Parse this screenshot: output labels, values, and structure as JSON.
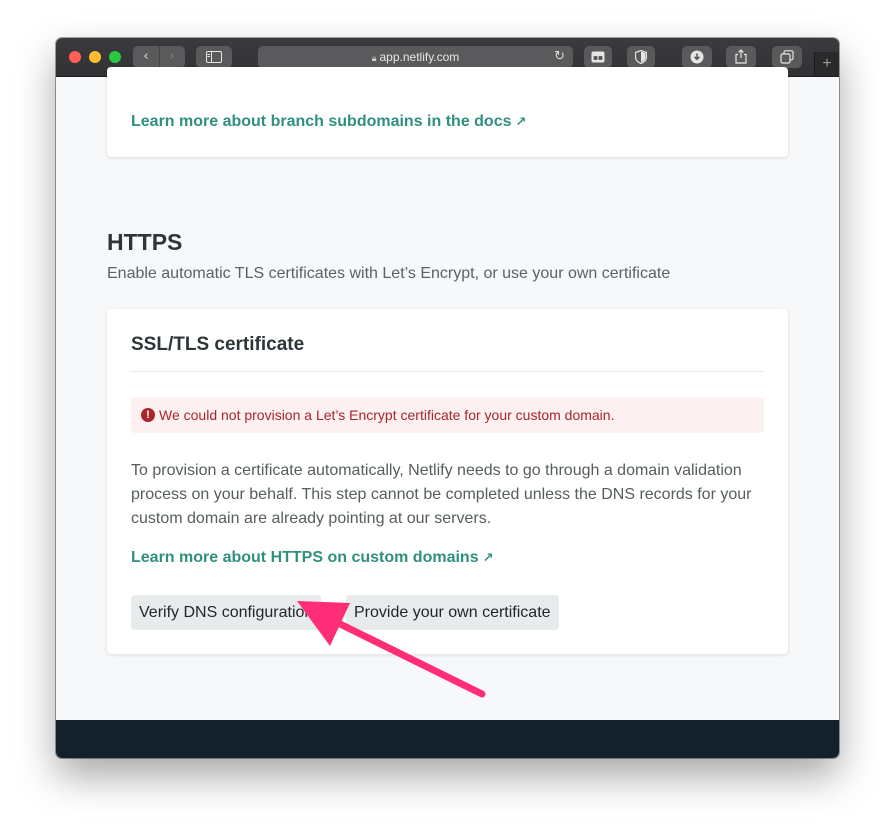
{
  "browser": {
    "url": "app.netlify.com",
    "icons": {
      "back": "chevron-left-icon",
      "forward": "chevron-right-icon",
      "sidebar": "sidebar-icon",
      "lock": "lock-icon",
      "reload": "reload-icon",
      "extension": "extension-icon",
      "shield": "shield-icon",
      "download": "download-icon",
      "share": "share-icon",
      "tabs": "tabs-icon",
      "new_tab": "plus-icon"
    }
  },
  "branch_card": {
    "link": "Learn more about branch subdomains in the docs",
    "link_arrow": "↗"
  },
  "https_section": {
    "title": "HTTPS",
    "subtitle": "Enable automatic TLS certificates with Let’s Encrypt, or use your own certificate"
  },
  "ssl_card": {
    "title": "SSL/TLS certificate",
    "alert_icon": "!",
    "alert": "We could not provision a Let’s Encrypt certificate for your custom domain.",
    "paragraph": "To provision a certificate automatically, Netlify needs to go through a domain validation process on your behalf. This step cannot be completed unless the DNS records for your custom domain are already pointing at our servers.",
    "link": "Learn more about HTTPS on custom domains",
    "link_arrow": "↗",
    "buttons": {
      "verify": "Verify DNS configuration",
      "provide": "Provide your own certificate"
    }
  },
  "colors": {
    "accent_link": "#30907f",
    "alert_text": "#a8262c",
    "alert_bg": "#fcf0f0",
    "annotation_arrow": "#ff2e77",
    "footer": "#14202a"
  }
}
